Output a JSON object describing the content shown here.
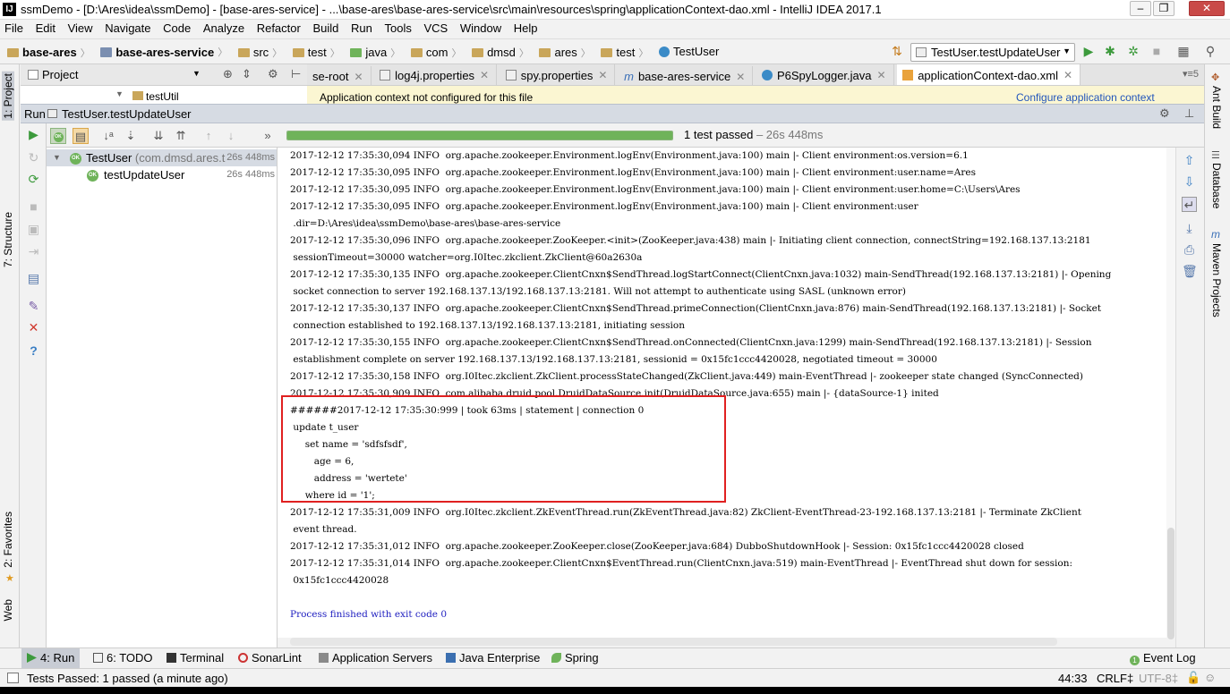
{
  "window": {
    "app_letters": "IJ",
    "title": "ssmDemo - [D:\\Ares\\idea\\ssmDemo] - [base-ares-service] - ...\\base-ares\\base-ares-service\\src\\main\\resources\\spring\\applicationContext-dao.xml - IntelliJ IDEA 2017.1"
  },
  "menu": [
    "File",
    "Edit",
    "View",
    "Navigate",
    "Code",
    "Analyze",
    "Refactor",
    "Build",
    "Run",
    "Tools",
    "VCS",
    "Window",
    "Help"
  ],
  "breadcrumbs": [
    "base-ares",
    "base-ares-service",
    "src",
    "test",
    "java",
    "com",
    "dmsd",
    "ares",
    "test",
    "TestUser"
  ],
  "run_config": "TestUser.testUpdateUser",
  "left_tabs": {
    "project": "1: Project",
    "structure": "7: Structure",
    "favorites": "2: Favorites",
    "web": "Web"
  },
  "right_tabs": {
    "ant": "Ant Build",
    "database": "Database",
    "maven": "Maven Projects"
  },
  "project_panel": {
    "title": "Project",
    "peek_row": "testUtil"
  },
  "editor_tabs": [
    {
      "label": "se-root",
      "icon": "xml-icon"
    },
    {
      "label": "log4j.properties",
      "icon": "properties-icon"
    },
    {
      "label": "spy.properties",
      "icon": "properties-icon"
    },
    {
      "label": "base-ares-service",
      "icon": "maven-icon"
    },
    {
      "label": "P6SpyLogger.java",
      "icon": "class-icon"
    },
    {
      "label": "applicationContext-dao.xml",
      "icon": "spring-xml-icon",
      "active": true
    }
  ],
  "editor_banner": {
    "text": "Application context not configured for this file",
    "link": "Configure application context"
  },
  "run_panel": {
    "label": "Run",
    "config": "TestUser.testUpdateUser"
  },
  "test_tree": [
    {
      "name": "TestUser",
      "suffix": "(com.dmsd.ares.t",
      "duration": "26s 448ms"
    },
    {
      "name": "testUpdateUser",
      "suffix": "",
      "duration": "26s 448ms"
    }
  ],
  "ok_badge": "OK",
  "progress": {
    "fraction": 1.0,
    "status": "1 test passed",
    "time": "– 26s 448ms"
  },
  "console_lines": [
    "2017-12-12 17:35:30,094 INFO  org.apache.zookeeper.Environment.logEnv(Environment.java:100) main |- Client environment:os.version=6.1",
    "2017-12-12 17:35:30,095 INFO  org.apache.zookeeper.Environment.logEnv(Environment.java:100) main |- Client environment:user.name=Ares",
    "2017-12-12 17:35:30,095 INFO  org.apache.zookeeper.Environment.logEnv(Environment.java:100) main |- Client environment:user.home=C:\\Users\\Ares",
    "2017-12-12 17:35:30,095 INFO  org.apache.zookeeper.Environment.logEnv(Environment.java:100) main |- Client environment:user",
    " .dir=D:\\Ares\\idea\\ssmDemo\\base-ares\\base-ares-service",
    "2017-12-12 17:35:30,096 INFO  org.apache.zookeeper.ZooKeeper.<init>(ZooKeeper.java:438) main |- Initiating client connection, connectString=192.168.137.13:2181",
    " sessionTimeout=30000 watcher=org.I0Itec.zkclient.ZkClient@60a2630a",
    "2017-12-12 17:35:30,135 INFO  org.apache.zookeeper.ClientCnxn$SendThread.logStartConnect(ClientCnxn.java:1032) main-SendThread(192.168.137.13:2181) |- Opening",
    " socket connection to server 192.168.137.13/192.168.137.13:2181. Will not attempt to authenticate using SASL (unknown error)",
    "2017-12-12 17:35:30,137 INFO  org.apache.zookeeper.ClientCnxn$SendThread.primeConnection(ClientCnxn.java:876) main-SendThread(192.168.137.13:2181) |- Socket",
    " connection established to 192.168.137.13/192.168.137.13:2181, initiating session",
    "2017-12-12 17:35:30,155 INFO  org.apache.zookeeper.ClientCnxn$SendThread.onConnected(ClientCnxn.java:1299) main-SendThread(192.168.137.13:2181) |- Session",
    " establishment complete on server 192.168.137.13/192.168.137.13:2181, sessionid = 0x15fc1ccc4420028, negotiated timeout = 30000",
    "2017-12-12 17:35:30,158 INFO  org.I0Itec.zkclient.ZkClient.processStateChanged(ZkClient.java:449) main-EventThread |- zookeeper state changed (SyncConnected)",
    "2017-12-12 17:35:30,909 INFO  com.alibaba.druid.pool.DruidDataSource.init(DruidDataSource.java:655) main |- {dataSource-1} inited",
    "######2017-12-12 17:35:30:999 | took 63ms | statement | connection 0",
    " update t_user",
    "     set name = 'sdfsfsdf',",
    "        age = 6,",
    "        address = 'wertete'",
    "     where id = '1';",
    "2017-12-12 17:35:31,009 INFO  org.I0Itec.zkclient.ZkEventThread.run(ZkEventThread.java:82) ZkClient-EventThread-23-192.168.137.13:2181 |- Terminate ZkClient",
    " event thread.",
    "2017-12-12 17:35:31,012 INFO  org.apache.zookeeper.ZooKeeper.close(ZooKeeper.java:684) DubboShutdownHook |- Session: 0x15fc1ccc4420028 closed",
    "2017-12-12 17:35:31,014 INFO  org.apache.zookeeper.ClientCnxn$EventThread.run(ClientCnxn.java:519) main-EventThread |- EventThread shut down for session:",
    " 0x15fc1ccc4420028",
    "",
    "Process finished with exit code 0"
  ],
  "bottom_tabs": [
    {
      "label": "4: Run",
      "icon": "run-icon",
      "active": true
    },
    {
      "label": "6: TODO",
      "icon": "todo-icon"
    },
    {
      "label": "Terminal",
      "icon": "terminal-icon"
    },
    {
      "label": "SonarLint",
      "icon": "sonarlint-icon"
    },
    {
      "label": "Application Servers",
      "icon": "app-servers-icon"
    },
    {
      "label": "Java Enterprise",
      "icon": "java-enterprise-icon"
    },
    {
      "label": "Spring",
      "icon": "spring-icon"
    }
  ],
  "event_log": {
    "label": "Event Log",
    "count": "1"
  },
  "status": {
    "message": "Tests Passed: 1 passed (a minute ago)",
    "position": "44:33",
    "line_sep": "CRLF‡",
    "encoding": "UTF-8‡"
  },
  "colors": {
    "pass_green": "#6fb35a",
    "highlight_red": "#e02020",
    "exit_blue": "#2020c0"
  }
}
